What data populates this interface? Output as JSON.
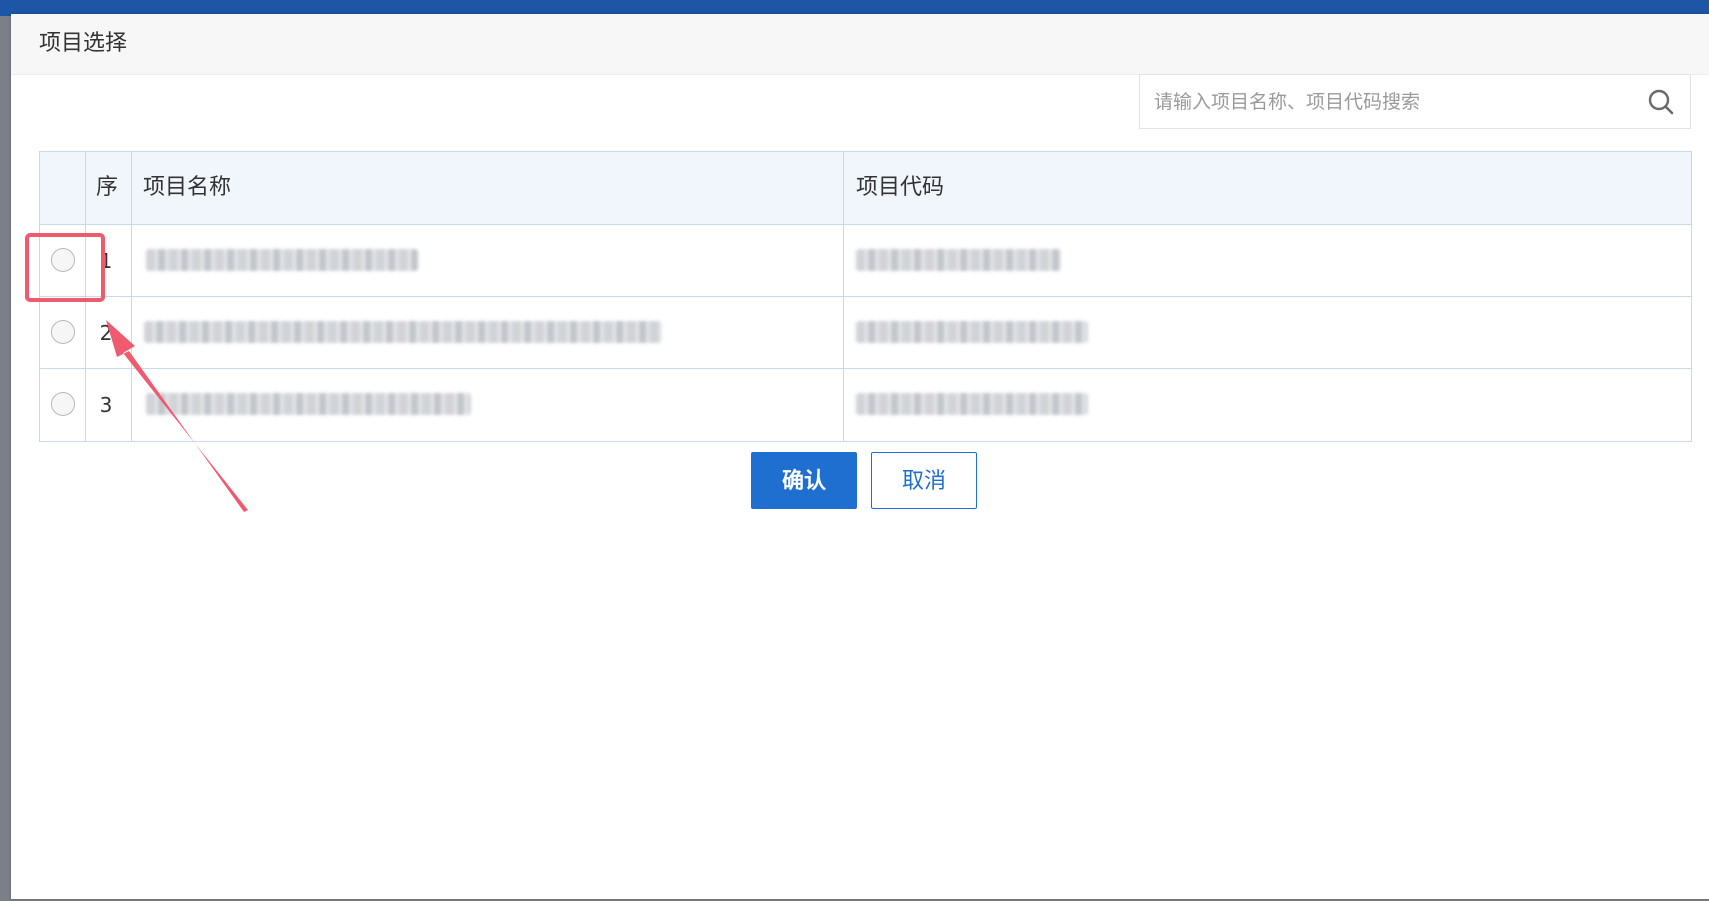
{
  "dialog": {
    "title": "项目选择"
  },
  "search": {
    "placeholder": "请输入项目名称、项目代码搜索",
    "value": "",
    "icon": "search-icon"
  },
  "table": {
    "columns": {
      "select": "",
      "seq": "序",
      "name": "项目名称",
      "code": "项目代码"
    },
    "rows": [
      {
        "seq": "1",
        "name": "",
        "code": "",
        "selected": false
      },
      {
        "seq": "2",
        "name": "",
        "code": "",
        "selected": false
      },
      {
        "seq": "3",
        "name": "",
        "code": "",
        "selected": false
      }
    ]
  },
  "buttons": {
    "confirm": "确认",
    "cancel": "取消"
  },
  "colors": {
    "accent": "#1e6fd0",
    "annotation": "#ef5a6e",
    "header_bg": "#f0f6fc",
    "grid_line": "#c8d9ec"
  }
}
